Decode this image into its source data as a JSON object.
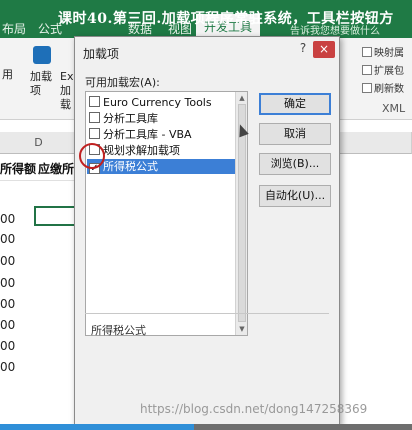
{
  "video_title": "课时40.第三回.加载项程序常驻系统，工具栏按钮方",
  "ribbon": {
    "tabs": [
      "布局",
      "公式",
      "数据",
      "视图",
      "开发工具"
    ],
    "search_hint": "告诉我您想要做什么",
    "left_labels": [
      "用",
      "加载项",
      "Ex加载"
    ],
    "right_items": [
      "映射属",
      "扩展包",
      "刷新数"
    ],
    "group_label": "XML"
  },
  "sheet": {
    "columns": [
      "D"
    ],
    "header_cells": [
      "所得额",
      "应缴所"
    ],
    "row_values": [
      "00",
      "00",
      "00",
      "00",
      "00",
      "00",
      "00",
      "00"
    ]
  },
  "dialog": {
    "title": "加载项",
    "help_label": "?",
    "close_label": "×",
    "list_label": "可用加载宏(A):",
    "addins": [
      {
        "label": "Euro Currency Tools",
        "checked": false
      },
      {
        "label": "分析工具库",
        "checked": false
      },
      {
        "label": "分析工具库 - VBA",
        "checked": false
      },
      {
        "label": "规划求解加载项",
        "checked": false
      },
      {
        "label": "所得税公式",
        "checked": true,
        "selected": true
      }
    ],
    "buttons": {
      "ok": "确定",
      "cancel": "取消",
      "browse": "浏览(B)...",
      "automation": "自动化(U)..."
    },
    "description": "所得税公式"
  },
  "watermark": "https://blog.csdn.net/dong147258369",
  "video_progress": 0.47,
  "colors": {
    "excel_green": "#1f7a45",
    "selection_blue": "#3c7fd6",
    "annotation_red": "#c02020"
  }
}
